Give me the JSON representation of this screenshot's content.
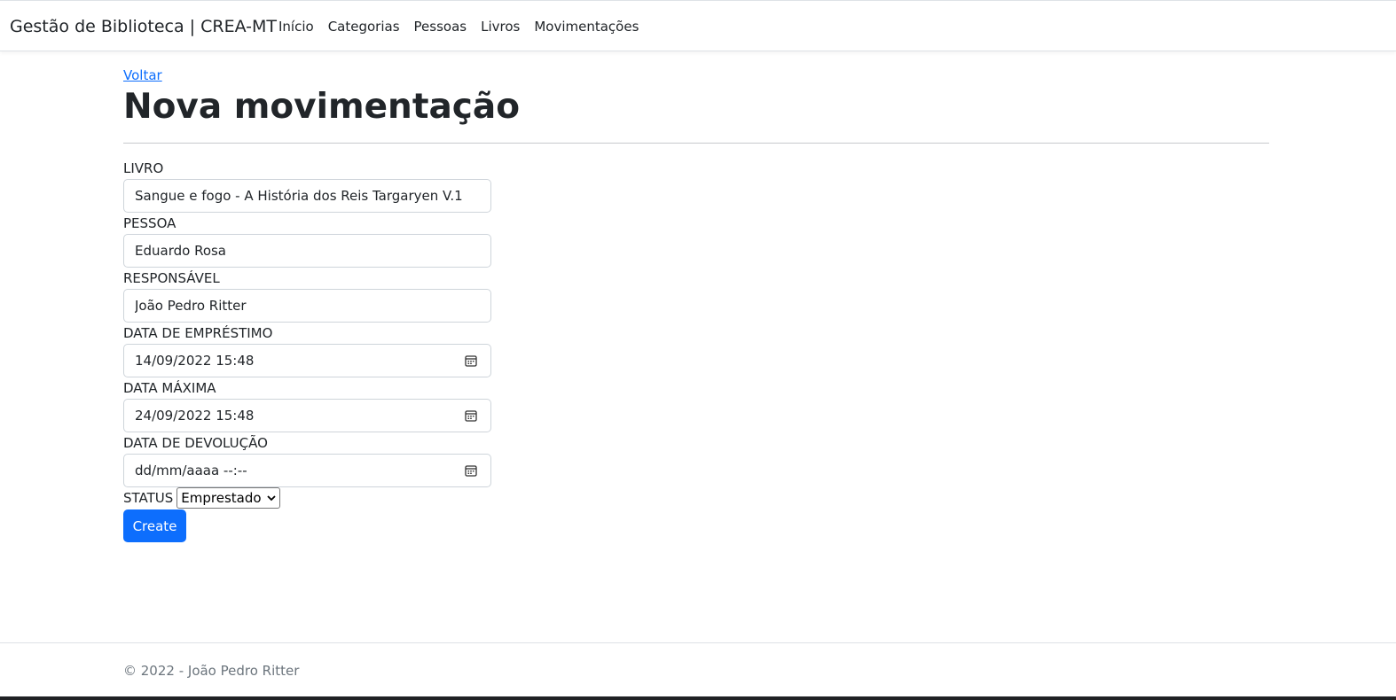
{
  "navbar": {
    "brand": "Gestão de Biblioteca | CREA-MT",
    "links": [
      "Início",
      "Categorias",
      "Pessoas",
      "Livros",
      "Movimentações"
    ]
  },
  "page": {
    "back_link": "Voltar",
    "title": "Nova movimentação"
  },
  "form": {
    "livro": {
      "label": "LIVRO",
      "value": "Sangue e fogo - A História dos Reis Targaryen V.1"
    },
    "pessoa": {
      "label": "PESSOA",
      "value": "Eduardo Rosa"
    },
    "responsavel": {
      "label": "RESPONSÁVEL",
      "value": "João Pedro Ritter"
    },
    "data_emprestimo": {
      "label": "DATA DE EMPRÉSTIMO",
      "value": "14/09/2022 15:48"
    },
    "data_maxima": {
      "label": "DATA MÁXIMA",
      "value": "24/09/2022 15:48"
    },
    "data_devolucao": {
      "label": "DATA DE DEVOLUÇÃO",
      "value": "dd/mm/aaaa --:--"
    },
    "status": {
      "label": "STATUS",
      "value": "Emprestado"
    },
    "submit_label": "Create"
  },
  "footer": {
    "text": "© 2022 - João Pedro Ritter"
  },
  "colors": {
    "primary": "#0d6efd",
    "text": "#212529",
    "muted": "#6c757d",
    "border": "#ced4da"
  },
  "icons": {
    "date_picker": "calendar-icon",
    "select": "chevron-down-icon"
  }
}
